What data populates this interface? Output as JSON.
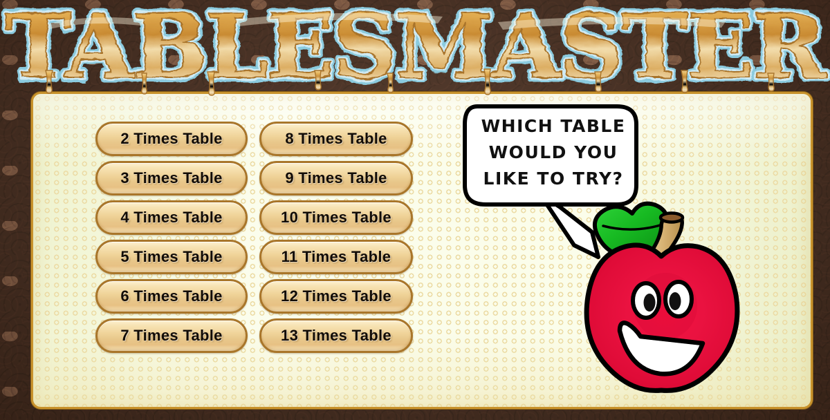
{
  "app": {
    "title": "TABLESMASTER",
    "title_letters": [
      "T",
      "A",
      "B",
      "L",
      "E",
      "S",
      "M",
      "A",
      "S",
      "T",
      "E",
      "R"
    ]
  },
  "theme": {
    "stone_border": "#6b4630",
    "panel_bg": "#f7fade",
    "panel_dot": "#ecdca6",
    "panel_border": "#c8922c",
    "button_fill_top": "#fdf0cf",
    "button_fill_bottom": "#e7c184",
    "button_border": "#a9762a",
    "button_text": "#120c06",
    "title_gold": "#e8bb62",
    "title_outline": "#8fd3e8",
    "apple_red": "#e8143c",
    "apple_red_dark": "#c00d30",
    "leaf_green": "#19b524",
    "leaf_green_dark": "#0d8a18",
    "stem_tan": "#d9b678",
    "bubble_fill": "#ffffff",
    "bubble_stroke": "#000000"
  },
  "character": {
    "name": "apple-mascot",
    "expression": "smiling"
  },
  "speech_bubble": {
    "name": "which-table-prompt",
    "lines": [
      "WHICH TABLE",
      "WOULD YOU",
      "LIKE TO TRY?"
    ],
    "full_text": "WHICH TABLE WOULD YOU LIKE TO TRY?"
  },
  "menu": {
    "columns": [
      {
        "name": "left-column",
        "buttons": [
          {
            "label": "2 Times Table",
            "table": 2
          },
          {
            "label": "3 Times Table",
            "table": 3
          },
          {
            "label": "4 Times Table",
            "table": 4
          },
          {
            "label": "5 Times Table",
            "table": 5
          },
          {
            "label": "6 Times Table",
            "table": 6
          },
          {
            "label": "7 Times Table",
            "table": 7
          }
        ]
      },
      {
        "name": "right-column",
        "buttons": [
          {
            "label": "8 Times Table",
            "table": 8
          },
          {
            "label": "9 Times Table",
            "table": 9
          },
          {
            "label": "10 Times Table",
            "table": 10
          },
          {
            "label": "11 Times Table",
            "table": 11
          },
          {
            "label": "12 Times Table",
            "table": 12
          },
          {
            "label": "13 Times Table",
            "table": 13
          }
        ]
      }
    ]
  }
}
